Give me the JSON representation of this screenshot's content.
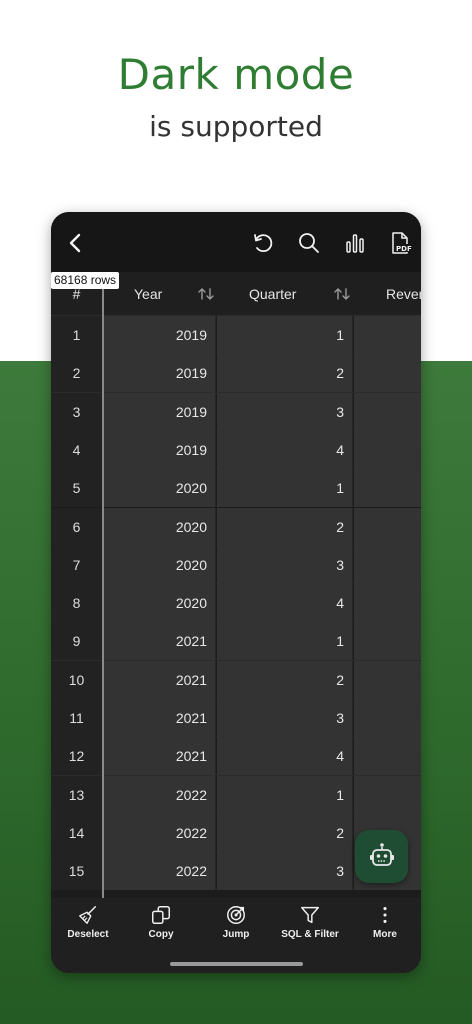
{
  "promo": {
    "headline": "Dark mode",
    "subheadline": "is supported"
  },
  "colors": {
    "headline": "#2e7d32",
    "background_lower": "#2f6a2d",
    "fab": "#1f4d33"
  },
  "toolbar": {
    "icons": [
      "back-arrow-icon",
      "undo-icon",
      "search-icon",
      "chart-icon",
      "pdf-icon"
    ],
    "pdf_text": "PDF"
  },
  "table": {
    "row_count_badge": "68168 rows",
    "columns": [
      {
        "label": "#"
      },
      {
        "label": "Year"
      },
      {
        "label": "Quarter"
      },
      {
        "label": "Rever"
      }
    ],
    "rows": [
      {
        "idx": "1",
        "year": "2019",
        "quarter": "1"
      },
      {
        "idx": "2",
        "year": "2019",
        "quarter": "2"
      },
      {
        "idx": "3",
        "year": "2019",
        "quarter": "3"
      },
      {
        "idx": "4",
        "year": "2019",
        "quarter": "4"
      },
      {
        "idx": "5",
        "year": "2020",
        "quarter": "1"
      },
      {
        "idx": "6",
        "year": "2020",
        "quarter": "2"
      },
      {
        "idx": "7",
        "year": "2020",
        "quarter": "3"
      },
      {
        "idx": "8",
        "year": "2020",
        "quarter": "4"
      },
      {
        "idx": "9",
        "year": "2021",
        "quarter": "1"
      },
      {
        "idx": "10",
        "year": "2021",
        "quarter": "2"
      },
      {
        "idx": "11",
        "year": "2021",
        "quarter": "3"
      },
      {
        "idx": "12",
        "year": "2021",
        "quarter": "4"
      },
      {
        "idx": "13",
        "year": "2022",
        "quarter": "1"
      },
      {
        "idx": "14",
        "year": "2022",
        "quarter": "2"
      },
      {
        "idx": "15",
        "year": "2022",
        "quarter": "3"
      }
    ]
  },
  "bottom_bar": {
    "items": [
      {
        "label": "Deselect",
        "icon": "broom-icon"
      },
      {
        "label": "Copy",
        "icon": "copy-icon"
      },
      {
        "label": "Jump",
        "icon": "target-icon"
      },
      {
        "label": "SQL & Filter",
        "icon": "filter-icon"
      },
      {
        "label": "More",
        "icon": "more-vertical-icon"
      }
    ]
  },
  "fab": {
    "icon": "robot-icon"
  }
}
